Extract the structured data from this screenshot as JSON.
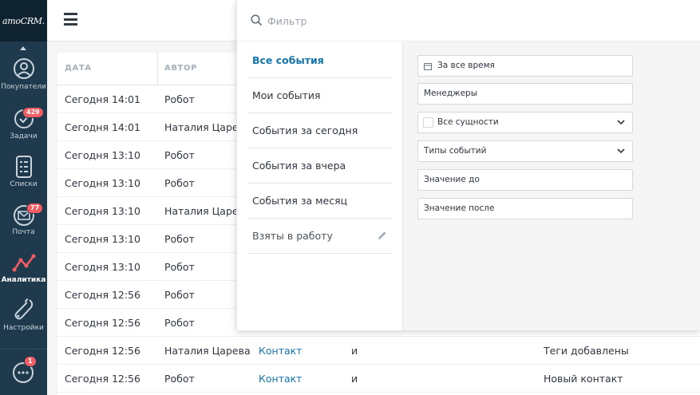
{
  "sidebar": {
    "logo": "amoCRM.",
    "items": [
      {
        "label": "Покупатели",
        "icon": "customers-icon",
        "badge": ""
      },
      {
        "label": "Задачи",
        "icon": "tasks-icon",
        "badge": "429"
      },
      {
        "label": "Списки",
        "icon": "lists-icon",
        "badge": ""
      },
      {
        "label": "Почта",
        "icon": "mail-icon",
        "badge": "77"
      },
      {
        "label": "Аналитика",
        "icon": "analytics-icon",
        "badge": "",
        "active": true
      },
      {
        "label": "Настройки",
        "icon": "settings-icon",
        "badge": ""
      }
    ],
    "chat_badge": "1"
  },
  "filter": {
    "search_placeholder": "Фильтр",
    "presets": [
      {
        "label": "Все события",
        "active": true
      },
      {
        "label": "Мои события"
      },
      {
        "label": "События за сегодня"
      },
      {
        "label": "События за вчера"
      },
      {
        "label": "События за месяц"
      },
      {
        "label": "Взяты в работу",
        "editable": true
      }
    ],
    "fields": {
      "period": "За все время",
      "managers": "Менеджеры",
      "entities": "Все сущности",
      "event_types": "Типы событий",
      "value_before": "Значение до",
      "value_after": "Значение после"
    }
  },
  "table": {
    "headers": {
      "date": "ДАТА",
      "author": "АВТОР"
    },
    "rows": [
      {
        "date": "Сегодня 14:01",
        "author": "Робот",
        "entity": "",
        "name": "",
        "event": ""
      },
      {
        "date": "Сегодня 14:01",
        "author": "Наталия Царева",
        "entity": "",
        "name": "",
        "event": ""
      },
      {
        "date": "Сегодня 13:10",
        "author": "Робот",
        "entity": "",
        "name": "",
        "event": ""
      },
      {
        "date": "Сегодня 13:10",
        "author": "Робот",
        "entity": "",
        "name": "",
        "event": ""
      },
      {
        "date": "Сегодня 13:10",
        "author": "Наталия Царева",
        "entity": "",
        "name": "",
        "event": ""
      },
      {
        "date": "Сегодня 13:10",
        "author": "Робот",
        "entity": "",
        "name": "",
        "event": ""
      },
      {
        "date": "Сегодня 13:10",
        "author": "Робот",
        "entity": "",
        "name": "",
        "event": ""
      },
      {
        "date": "Сегодня 12:56",
        "author": "Робот",
        "entity": "",
        "name": "",
        "event": ""
      },
      {
        "date": "Сегодня 12:56",
        "author": "Робот",
        "entity": "",
        "name": "",
        "event": ""
      },
      {
        "date": "Сегодня 12:56",
        "author": "Наталия Царева",
        "entity": "Контакт",
        "name": "и",
        "event": "Теги добавлены"
      },
      {
        "date": "Сегодня 12:56",
        "author": "Робот",
        "entity": "Контакт",
        "name": "и",
        "event": "Новый контакт"
      }
    ]
  },
  "colors": {
    "sidebar_bg": "#1e3a4c",
    "accent": "#1375ab",
    "badge": "#f25c63"
  }
}
